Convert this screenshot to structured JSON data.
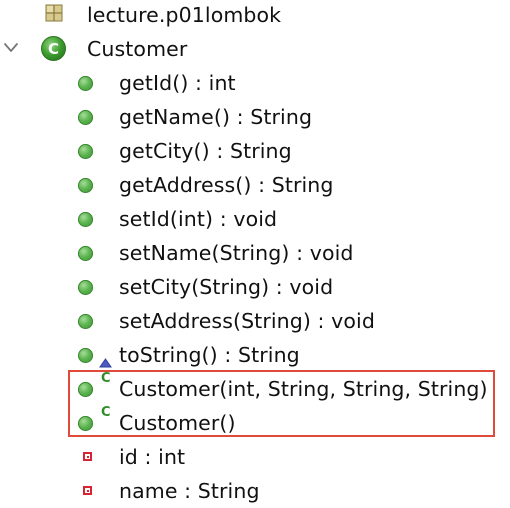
{
  "tree": {
    "package": {
      "label": "lecture.p01lombok",
      "icon": "package-icon"
    },
    "class": {
      "label": "Customer",
      "icon": "class-icon",
      "expanded": true
    },
    "members": [
      {
        "label": "getId() : int",
        "kind": "method"
      },
      {
        "label": "getName() : String",
        "kind": "method"
      },
      {
        "label": "getCity() : String",
        "kind": "method"
      },
      {
        "label": "getAddress() : String",
        "kind": "method"
      },
      {
        "label": "setId(int) : void",
        "kind": "method"
      },
      {
        "label": "setName(String) : void",
        "kind": "method"
      },
      {
        "label": "setCity(String) : void",
        "kind": "method"
      },
      {
        "label": "setAddress(String) : void",
        "kind": "method"
      },
      {
        "label": "toString() : String",
        "kind": "method-override"
      },
      {
        "label": "Customer(int, String, String, String)",
        "kind": "constructor"
      },
      {
        "label": "Customer()",
        "kind": "constructor"
      },
      {
        "label": "id : int",
        "kind": "field"
      },
      {
        "label": "name : String",
        "kind": "field"
      }
    ],
    "constructor_marker": "C"
  },
  "colors": {
    "method_green": "#5bb34f",
    "field_red": "#d62434",
    "highlight_border": "#e04a3a",
    "class_icon_green": "#3d9b2f",
    "override_blue": "#2f3f9e"
  }
}
